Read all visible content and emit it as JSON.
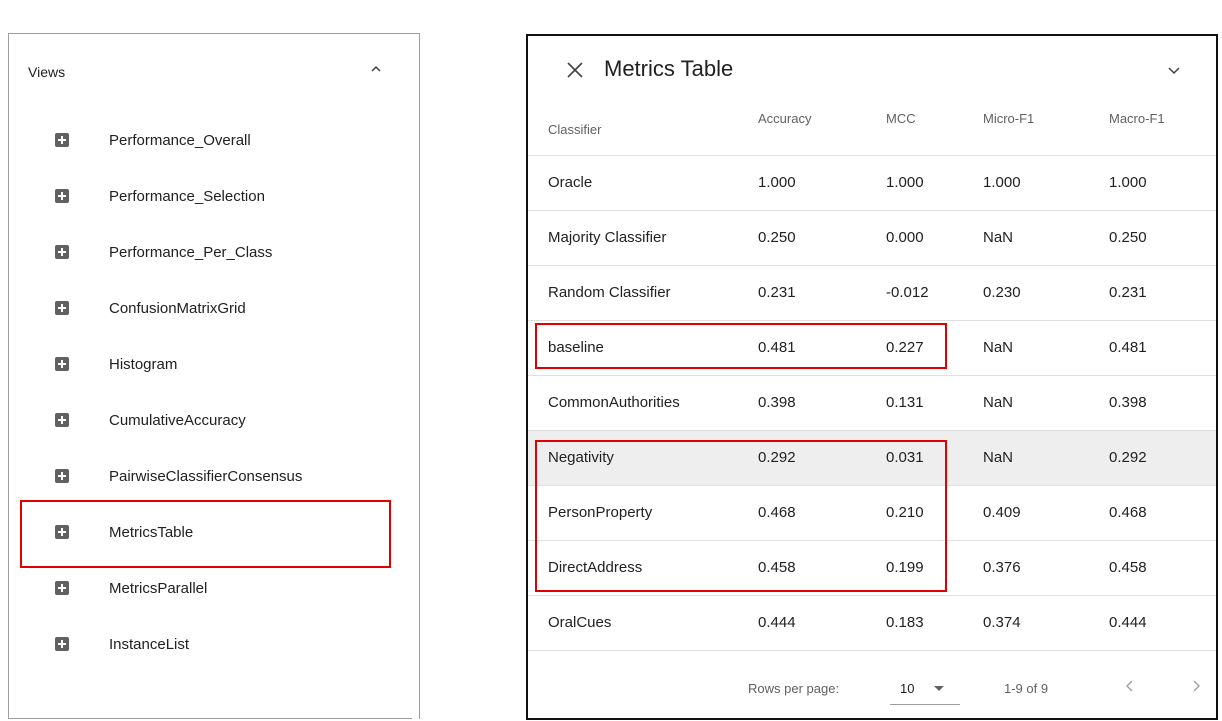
{
  "views": {
    "header": "Views",
    "items": [
      {
        "label": "Performance_Overall"
      },
      {
        "label": "Performance_Selection"
      },
      {
        "label": "Performance_Per_Class"
      },
      {
        "label": "ConfusionMatrixGrid"
      },
      {
        "label": "Histogram"
      },
      {
        "label": "CumulativeAccuracy"
      },
      {
        "label": "PairwiseClassifierConsensus"
      },
      {
        "label": "MetricsTable"
      },
      {
        "label": "MetricsParallel"
      },
      {
        "label": "InstanceList"
      }
    ]
  },
  "metrics_panel": {
    "title": "Metrics Table",
    "columns": [
      "Classifier",
      "Accuracy",
      "MCC",
      "Micro-F1",
      "Macro-F1"
    ],
    "rows": [
      {
        "classifier": "Oracle",
        "accuracy": "1.000",
        "mcc": "1.000",
        "micro_f1": "1.000",
        "macro_f1": "1.000"
      },
      {
        "classifier": "Majority Classifier",
        "accuracy": "0.250",
        "mcc": "0.000",
        "micro_f1": "NaN",
        "macro_f1": "0.250"
      },
      {
        "classifier": "Random Classifier",
        "accuracy": "0.231",
        "mcc": "-0.012",
        "micro_f1": "0.230",
        "macro_f1": "0.231"
      },
      {
        "classifier": "baseline",
        "accuracy": "0.481",
        "mcc": "0.227",
        "micro_f1": "NaN",
        "macro_f1": "0.481"
      },
      {
        "classifier": "CommonAuthorities",
        "accuracy": "0.398",
        "mcc": "0.131",
        "micro_f1": "NaN",
        "macro_f1": "0.398"
      },
      {
        "classifier": "Negativity",
        "accuracy": "0.292",
        "mcc": "0.031",
        "micro_f1": "NaN",
        "macro_f1": "0.292"
      },
      {
        "classifier": "PersonProperty",
        "accuracy": "0.468",
        "mcc": "0.210",
        "micro_f1": "0.409",
        "macro_f1": "0.468"
      },
      {
        "classifier": "DirectAddress",
        "accuracy": "0.458",
        "mcc": "0.199",
        "micro_f1": "0.376",
        "macro_f1": "0.458"
      },
      {
        "classifier": "OralCues",
        "accuracy": "0.444",
        "mcc": "0.183",
        "micro_f1": "0.374",
        "macro_f1": "0.444"
      }
    ],
    "footer": {
      "rows_per_page_label": "Rows per page:",
      "rows_per_page_value": "10",
      "range_text": "1-9 of 9"
    }
  },
  "colors": {
    "highlight": "#e00000",
    "shaded_row": "#eeeeee",
    "icon": "#616161"
  },
  "icons": [
    "chevron-up-icon",
    "plus-square-icon",
    "close-icon",
    "chevron-down-icon",
    "dropdown-arrow-icon",
    "chevron-left-icon",
    "chevron-right-icon"
  ]
}
